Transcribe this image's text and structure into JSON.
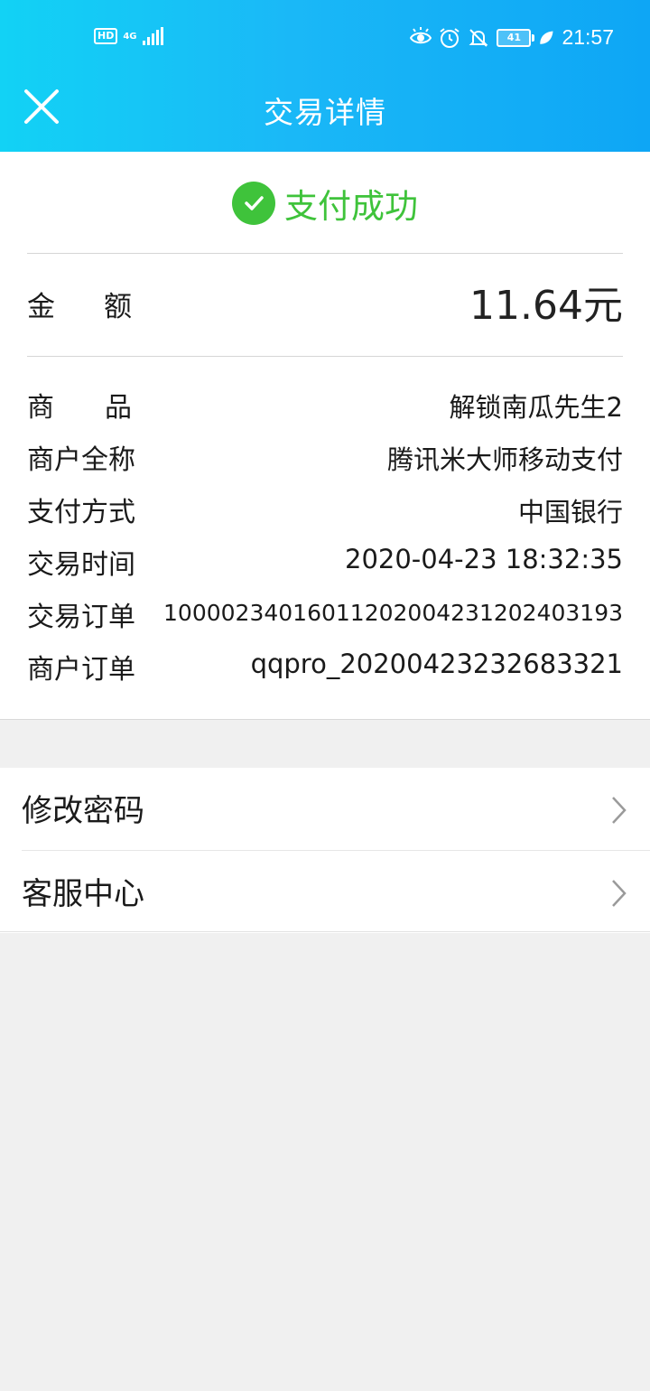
{
  "statusbar": {
    "hd": "HD",
    "network": "4G",
    "battery": "41",
    "time": "21:57"
  },
  "header": {
    "title": "交易详情"
  },
  "payment": {
    "status": "支付成功",
    "amount_label": "金额",
    "amount_value": "11.64元",
    "details": [
      {
        "label": "商品",
        "value": "解锁南瓜先生2"
      },
      {
        "label": "商户全称",
        "value": "腾讯米大师移动支付"
      },
      {
        "label": "支付方式",
        "value": "中国银行"
      },
      {
        "label": "交易时间",
        "value": "2020-04-23 18:32:35"
      },
      {
        "label": "交易订单",
        "value": "10000234016011202004231202403193"
      },
      {
        "label": "商户订单",
        "value": "qqpro_20200423232683321"
      }
    ]
  },
  "menu": {
    "items": [
      {
        "label": "修改密码"
      },
      {
        "label": "客服中心"
      }
    ]
  },
  "colors": {
    "header_gradient_start": "#12d2f5",
    "header_gradient_end": "#0ea6f5",
    "success_green": "#3fc33b",
    "background": "#f0f0f0"
  }
}
